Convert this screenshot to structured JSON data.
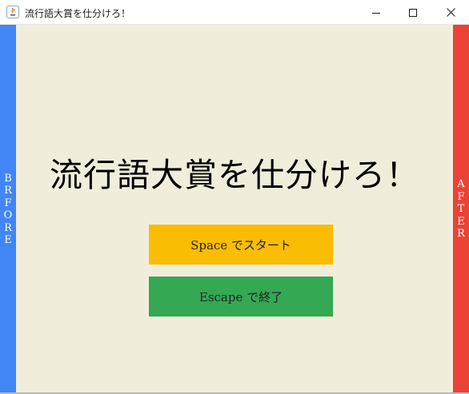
{
  "window": {
    "title": "流行語大賞を仕分けろ！",
    "icon": "java-app-icon",
    "controls": [
      "minimize-icon",
      "maximize-icon",
      "close-icon"
    ]
  },
  "game": {
    "heading": "流行語大賞を仕分けろ！",
    "left_side_label": [
      "B",
      "R",
      "F",
      "O",
      "R",
      "E"
    ],
    "right_side_label": [
      "A",
      "F",
      "T",
      "E",
      "R"
    ],
    "start_button_label": "Space でスタート",
    "quit_button_label": "Escape で終了"
  },
  "colors": {
    "background": "#f0eeda",
    "left_bar": "#4285f4",
    "right_bar": "#ea4335",
    "start_button": "#fbbc04",
    "quit_button": "#34a853"
  }
}
